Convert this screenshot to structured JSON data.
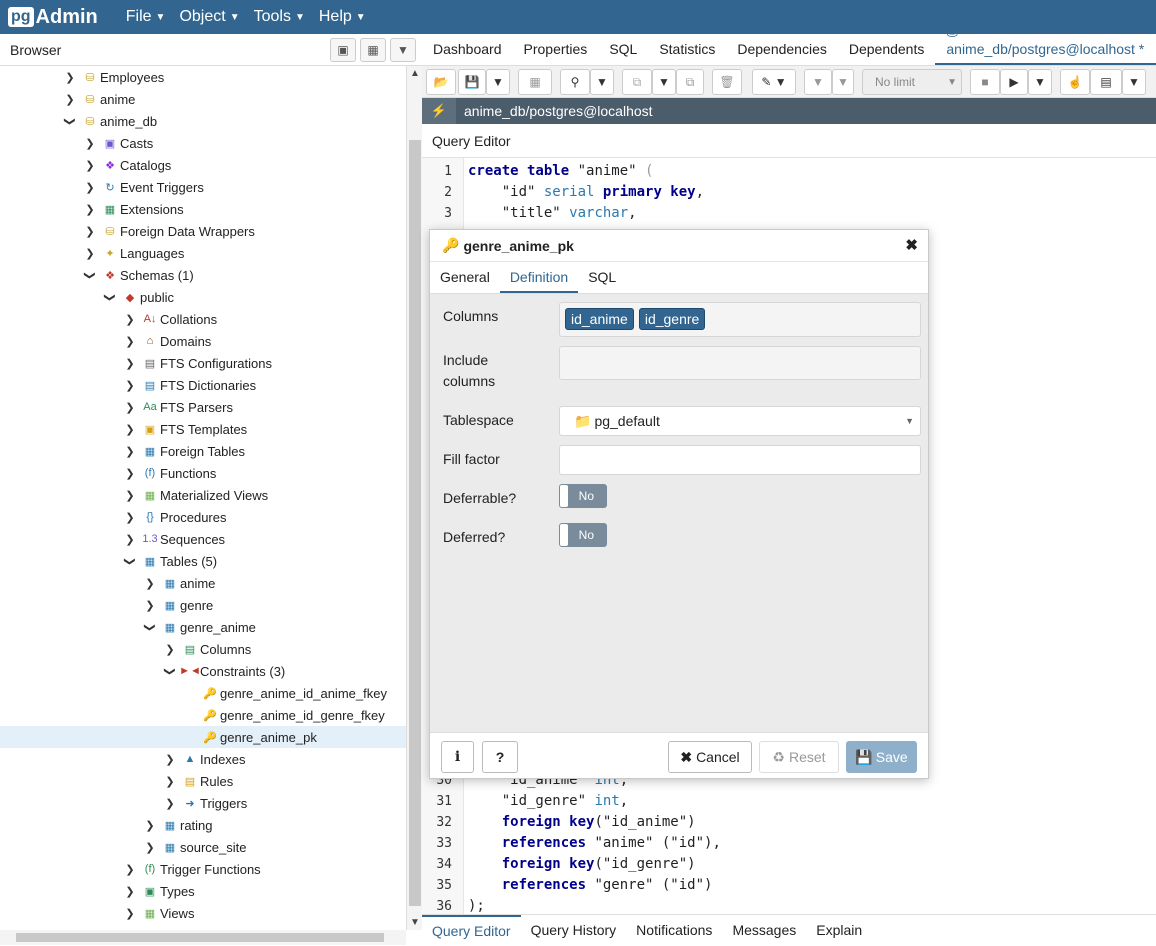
{
  "app": {
    "logo_pg": "pg",
    "logo_admin": "Admin"
  },
  "menu": [
    "File",
    "Object",
    "Tools",
    "Help"
  ],
  "browser": {
    "title": "Browser"
  },
  "tree": [
    {
      "label": "Employees",
      "level": 0,
      "chev": "right",
      "icon": "db-icon"
    },
    {
      "label": "anime",
      "level": 0,
      "chev": "right",
      "icon": "db-icon"
    },
    {
      "label": "anime_db",
      "level": 0,
      "chev": "down",
      "icon": "db-icon"
    },
    {
      "label": "Casts",
      "level": 1,
      "chev": "right",
      "icon": "casts-icon"
    },
    {
      "label": "Catalogs",
      "level": 1,
      "chev": "right",
      "icon": "catalogs-icon"
    },
    {
      "label": "Event Triggers",
      "level": 1,
      "chev": "right",
      "icon": "event-trigger-icon"
    },
    {
      "label": "Extensions",
      "level": 1,
      "chev": "right",
      "icon": "extension-icon"
    },
    {
      "label": "Foreign Data Wrappers",
      "level": 1,
      "chev": "right",
      "icon": "fdw-icon"
    },
    {
      "label": "Languages",
      "level": 1,
      "chev": "right",
      "icon": "language-icon"
    },
    {
      "label": "Schemas (1)",
      "level": 1,
      "chev": "down",
      "icon": "schemas-icon"
    },
    {
      "label": "public",
      "level": 2,
      "chev": "down",
      "icon": "schema-icon"
    },
    {
      "label": "Collations",
      "level": 3,
      "chev": "right",
      "icon": "collation-icon"
    },
    {
      "label": "Domains",
      "level": 3,
      "chev": "right",
      "icon": "domain-icon"
    },
    {
      "label": "FTS Configurations",
      "level": 3,
      "chev": "right",
      "icon": "fts-config-icon"
    },
    {
      "label": "FTS Dictionaries",
      "level": 3,
      "chev": "right",
      "icon": "fts-dict-icon"
    },
    {
      "label": "FTS Parsers",
      "level": 3,
      "chev": "right",
      "icon": "fts-parser-icon"
    },
    {
      "label": "FTS Templates",
      "level": 3,
      "chev": "right",
      "icon": "fts-template-icon"
    },
    {
      "label": "Foreign Tables",
      "level": 3,
      "chev": "right",
      "icon": "foreign-table-icon"
    },
    {
      "label": "Functions",
      "level": 3,
      "chev": "right",
      "icon": "function-icon"
    },
    {
      "label": "Materialized Views",
      "level": 3,
      "chev": "right",
      "icon": "matview-icon"
    },
    {
      "label": "Procedures",
      "level": 3,
      "chev": "right",
      "icon": "procedure-icon"
    },
    {
      "label": "Sequences",
      "level": 3,
      "chev": "right",
      "icon": "sequence-icon"
    },
    {
      "label": "Tables (5)",
      "level": 3,
      "chev": "down",
      "icon": "tables-icon"
    },
    {
      "label": "anime",
      "level": 4,
      "chev": "right",
      "icon": "table-icon"
    },
    {
      "label": "genre",
      "level": 4,
      "chev": "right",
      "icon": "table-icon"
    },
    {
      "label": "genre_anime",
      "level": 4,
      "chev": "down",
      "icon": "table-icon"
    },
    {
      "label": "Columns",
      "level": 5,
      "chev": "right",
      "icon": "columns-icon"
    },
    {
      "label": "Constraints (3)",
      "level": 5,
      "chev": "down",
      "icon": "constraints-icon"
    },
    {
      "label": "genre_anime_id_anime_fkey",
      "level": 6,
      "chev": "none",
      "icon": "foreign-key-icon"
    },
    {
      "label": "genre_anime_id_genre_fkey",
      "level": 6,
      "chev": "none",
      "icon": "foreign-key-icon"
    },
    {
      "label": "genre_anime_pk",
      "level": 6,
      "chev": "none",
      "icon": "primary-key-icon",
      "selected": true
    },
    {
      "label": "Indexes",
      "level": 5,
      "chev": "right",
      "icon": "index-icon"
    },
    {
      "label": "Rules",
      "level": 5,
      "chev": "right",
      "icon": "rule-icon"
    },
    {
      "label": "Triggers",
      "level": 5,
      "chev": "right",
      "icon": "trigger-icon"
    },
    {
      "label": "rating",
      "level": 4,
      "chev": "right",
      "icon": "table-icon"
    },
    {
      "label": "source_site",
      "level": 4,
      "chev": "right",
      "icon": "table-icon"
    },
    {
      "label": "Trigger Functions",
      "level": 3,
      "chev": "right",
      "icon": "trigger-function-icon"
    },
    {
      "label": "Types",
      "level": 3,
      "chev": "right",
      "icon": "type-icon"
    },
    {
      "label": "Views",
      "level": 3,
      "chev": "right",
      "icon": "view-icon"
    }
  ],
  "tabs": [
    "Dashboard",
    "Properties",
    "SQL",
    "Statistics",
    "Dependencies",
    "Dependents",
    "anime_db/postgres@localhost *"
  ],
  "toolbar": {
    "limit": "No limit"
  },
  "connection": "anime_db/postgres@localhost",
  "query_editor_title": "Query Editor",
  "code_top": [
    {
      "n": "1",
      "html": "<span class='kw'>create table</span> \"anime\" <span class='pu'>(</span>"
    },
    {
      "n": "2",
      "html": "    \"id\" <span class='ty'>serial</span> <span class='kw'>primary key</span>,"
    },
    {
      "n": "3",
      "html": "    \"title\" <span class='ty'>varchar</span>,"
    }
  ],
  "code_bottom": [
    {
      "n": "30",
      "html": "    \"id_anime\" <span class='ty'>int</span>,"
    },
    {
      "n": "31",
      "html": "    \"id_genre\" <span class='ty'>int</span>,"
    },
    {
      "n": "32",
      "html": "    <span class='kw'>foreign key</span>(\"id_anime\")"
    },
    {
      "n": "33",
      "html": "    <span class='kw'>references</span> \"anime\" (\"id\"),"
    },
    {
      "n": "34",
      "html": "    <span class='kw'>foreign key</span>(\"id_genre\")"
    },
    {
      "n": "35",
      "html": "    <span class='kw'>references</span> \"genre\" (\"id\")"
    },
    {
      "n": "36",
      "html": ");"
    }
  ],
  "bottom_tabs": [
    "Query Editor",
    "Query History",
    "Notifications",
    "Messages",
    "Explain"
  ],
  "dialog": {
    "title": "genre_anime_pk",
    "tabs": [
      "General",
      "Definition",
      "SQL"
    ],
    "labels": {
      "columns": "Columns",
      "include_1": "Include",
      "include_2": "columns",
      "tablespace": "Tablespace",
      "fill_factor": "Fill factor",
      "deferrable": "Deferrable?",
      "deferred": "Deferred?"
    },
    "columns": [
      "id_anime",
      "id_genre"
    ],
    "tablespace": "pg_default",
    "fill_factor": "",
    "deferrable": "No",
    "deferred": "No",
    "buttons": {
      "info": "i",
      "help": "?",
      "cancel": "Cancel",
      "reset": "Reset",
      "save": "Save"
    }
  },
  "colors": {
    "brand": "#326690",
    "header_dark": "#4b5c6b",
    "selected_row": "#e3f0fa"
  }
}
